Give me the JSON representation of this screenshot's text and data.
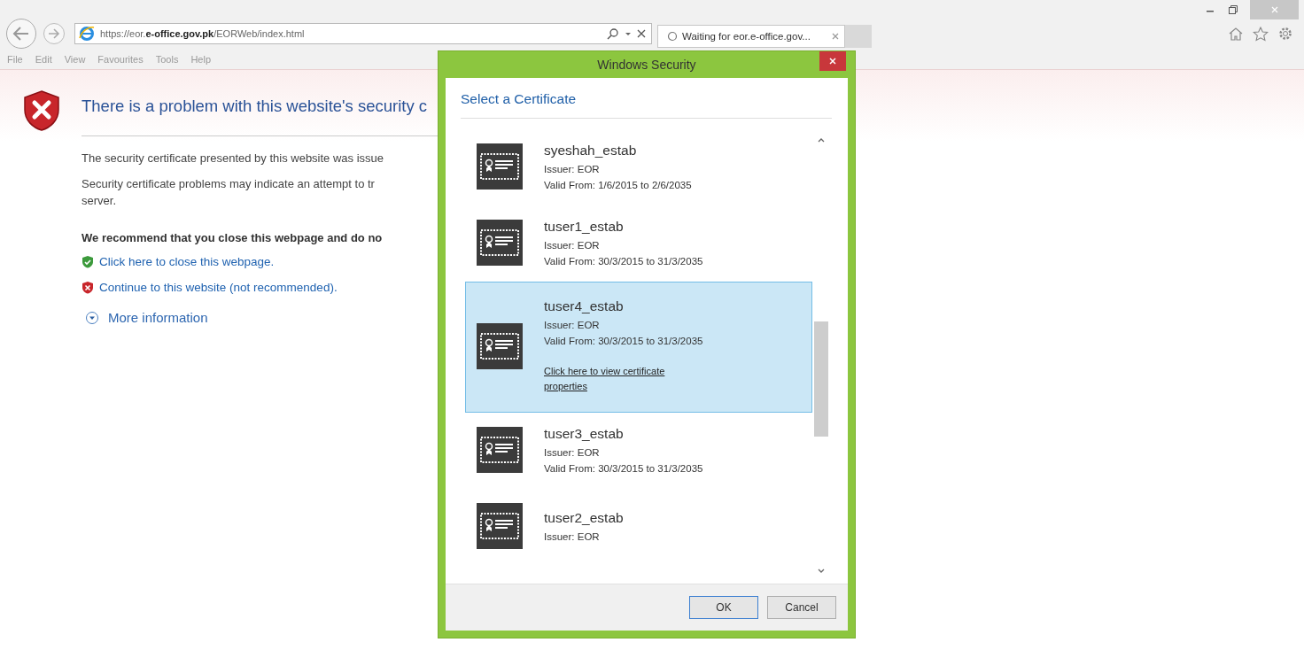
{
  "browser": {
    "address": "https://eor.**e-office.gov.pk**/EORWeb/index.html",
    "tabs": [
      {
        "label": "Waiting for eor.e-office.gov...",
        "selected": true
      }
    ],
    "menu": [
      "File",
      "Edit",
      "View",
      "Favourites",
      "Tools",
      "Help"
    ]
  },
  "page": {
    "title": "There is a problem with this website's security c",
    "paragraphs": [
      [
        "The security certificate presented by this website was issue"
      ],
      [
        "Security certificate problems may indicate an attempt to tr",
        "server."
      ]
    ],
    "recommendation": "We recommend that you close this webpage and do no",
    "links": [
      {
        "text": "Click here to close this webpage.",
        "kind": "safe"
      },
      {
        "text": "Continue to this website (not recommended).",
        "kind": "unsafe"
      }
    ],
    "more_info": "More information"
  },
  "dialog": {
    "title": "Windows Security",
    "heading": "Select a Certificate",
    "certificates": [
      {
        "name": "syeshah_estab",
        "issuer": "Issuer: EOR",
        "valid": "Valid From: 1/6/2015 to 2/6/2035",
        "selected": false
      },
      {
        "name": "tuser1_estab",
        "issuer": "Issuer: EOR",
        "valid": "Valid From: 30/3/2015 to 31/3/2035",
        "selected": false
      },
      {
        "name": "tuser4_estab",
        "issuer": "Issuer: EOR",
        "valid": "Valid From: 30/3/2015 to 31/3/2035",
        "selected": true,
        "link": "Click here to view certificate properties"
      },
      {
        "name": "tuser3_estab",
        "issuer": "Issuer: EOR",
        "valid": "Valid From: 30/3/2015 to 31/3/2035",
        "selected": false
      },
      {
        "name": "tuser2_estab",
        "issuer": "Issuer: EOR",
        "selected": false
      }
    ],
    "buttons": [
      {
        "label": "OK",
        "default": true
      },
      {
        "label": "Cancel",
        "default": false
      }
    ]
  }
}
